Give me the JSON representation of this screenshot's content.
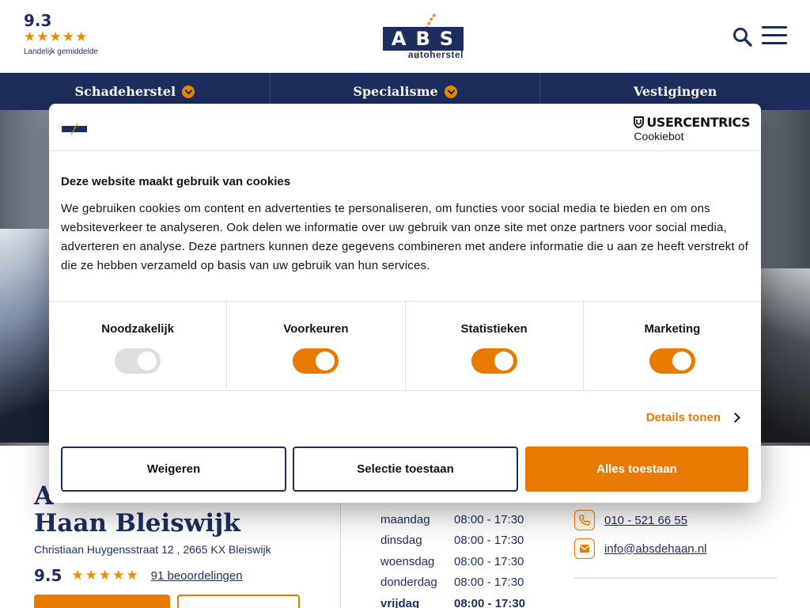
{
  "header": {
    "rating_score": "9.3",
    "rating_stars": "★★★★★",
    "rating_label": "Landelijk gemiddelde",
    "logo_text": "ABS",
    "logo_sub": "autoherstel"
  },
  "nav": {
    "items": [
      {
        "label": "Schadeherstel",
        "has_dropdown": true
      },
      {
        "label": "Specialisme",
        "has_dropdown": true
      },
      {
        "label": "Vestigingen",
        "has_dropdown": false
      }
    ]
  },
  "location": {
    "title_line1": "A",
    "title_line2": "Haan Bleiswijk",
    "address": "Christiaan Huygensstraat 12 , 2665 KX Bleiswijk",
    "rating_score": "9.5",
    "rating_stars": "★★★★★",
    "reviews": "91 beoordelingen"
  },
  "hours": [
    {
      "day": "maandag",
      "time": "08:00 - 17:30",
      "bold": false
    },
    {
      "day": "dinsdag",
      "time": "08:00 - 17:30",
      "bold": false
    },
    {
      "day": "woensdag",
      "time": "08:00 - 17:30",
      "bold": false
    },
    {
      "day": "donderdag",
      "time": "08:00 - 17:30",
      "bold": false
    },
    {
      "day": "vrijdag",
      "time": "08:00 - 17:30",
      "bold": true
    }
  ],
  "contact": {
    "phone": "010 - 521 66 55",
    "email": "info@absdehaan.nl"
  },
  "cookie": {
    "brand_top": "USERCENTRICS",
    "brand_bottom": "Cookiebot",
    "title": "Deze website maakt gebruik van cookies",
    "text": "We gebruiken cookies om content en advertenties te personaliseren, om functies voor social media te bieden en om ons websiteverkeer te analyseren. Ook delen we informatie over uw gebruik van onze site met onze partners voor social media, adverteren en analyse. Deze partners kunnen deze gegevens combineren met andere informatie die u aan ze heeft verstrekt of die ze hebben verzameld op basis van uw gebruik van hun services.",
    "toggles": [
      {
        "label": "Noodzakelijk",
        "on": false,
        "disabled": true
      },
      {
        "label": "Voorkeuren",
        "on": true,
        "disabled": false
      },
      {
        "label": "Statistieken",
        "on": true,
        "disabled": false
      },
      {
        "label": "Marketing",
        "on": true,
        "disabled": false
      }
    ],
    "details_label": "Details tonen",
    "btn_reject": "Weigeren",
    "btn_selection": "Selectie toestaan",
    "btn_all": "Alles toestaan"
  },
  "colors": {
    "brand_navy": "#1d2e5e",
    "accent_orange": "#e87a00"
  }
}
